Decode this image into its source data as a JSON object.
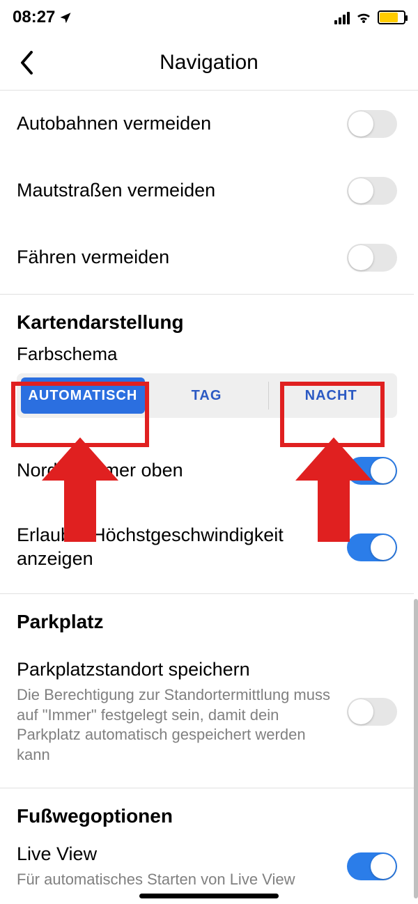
{
  "statusbar": {
    "time": "08:27"
  },
  "header": {
    "title": "Navigation"
  },
  "avoid": {
    "highways": "Autobahnen vermeiden",
    "tolls": "Mautstraßen vermeiden",
    "ferries": "Fähren vermeiden"
  },
  "mapdisplay": {
    "title": "Kartendarstellung",
    "colorscheme_label": "Farbschema",
    "segments": {
      "auto": "AUTOMATISCH",
      "day": "TAG",
      "night": "NACHT"
    },
    "north_up": "Norden immer oben",
    "speed_limit": "Erlaubte Höchstgeschwindigkeit anzeigen"
  },
  "parking": {
    "title": "Parkplatz",
    "save_label": "Parkplatzstandort speichern",
    "save_desc": "Die Berechtigung zur Standortermittlung muss auf \"Immer\" festgelegt sein, damit dein Parkplatz automatisch gespeichert werden kann"
  },
  "walking": {
    "title": "Fußwegoptionen",
    "liveview_label": "Live View",
    "liveview_desc": "Für automatisches Starten von Live View"
  },
  "toggles": {
    "highways": false,
    "tolls": false,
    "ferries": false,
    "north_up": true,
    "speed_limit": true,
    "parking_save": false,
    "liveview": true
  }
}
